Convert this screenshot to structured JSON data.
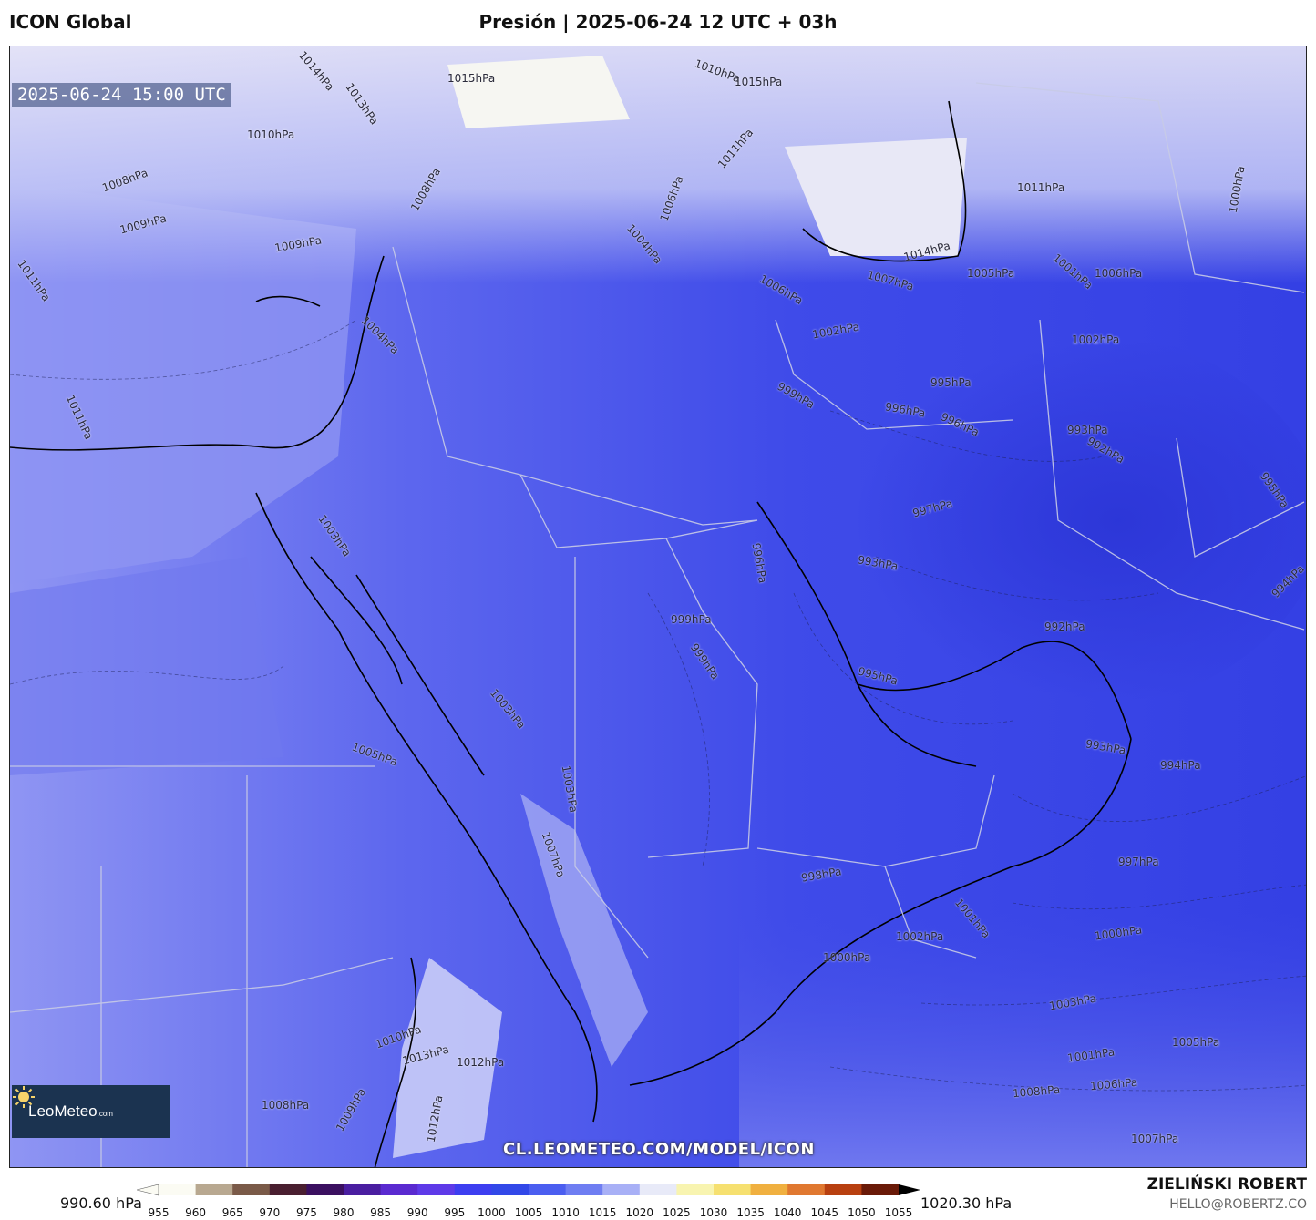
{
  "header": {
    "model": "ICON Global",
    "title": "Presión | 2025-06-24 12 UTC + 03h"
  },
  "map": {
    "valid_time": "2025-06-24 15:00 UTC",
    "url": "CL.LEOMETEO.COM/MODEL/ICON",
    "logo": {
      "name": "LeoMeteo",
      "suffix": ".com"
    },
    "isobar_labels": [
      "1015hPa",
      "1014hPa",
      "1013hPa",
      "1010hPa",
      "1008hPa",
      "1009hPa",
      "1009hPa",
      "1011hPa",
      "1008hPa",
      "1004hPa",
      "1011hPa",
      "1003hPa",
      "1003hPa",
      "1010hPa",
      "1015hPa",
      "1011hPa",
      "1006hPa",
      "1004hPa",
      "1006hPa",
      "1007hPa",
      "1014hPa",
      "1011hPa",
      "1005hPa",
      "1001hPa",
      "1006hPa",
      "1000hPa",
      "1002hPa",
      "1002hPa",
      "995hPa",
      "996hPa",
      "996hPa",
      "999hPa",
      "993hPa",
      "992hPa",
      "997hPa",
      "993hPa",
      "992hPa",
      "995hPa",
      "994hPa",
      "999hPa",
      "999hPa",
      "996hPa",
      "995hPa",
      "993hPa",
      "994hPa",
      "1003hPa",
      "1005hPa",
      "1001hPa",
      "1007hPa",
      "998hPa",
      "1001hPa",
      "1002hPa",
      "1000hPa",
      "1000hPa",
      "997hPa",
      "1003hPa",
      "1005hPa",
      "1006hPa",
      "1007hPa",
      "1008hPa",
      "1010hPa",
      "1013hPa",
      "1012hPa",
      "1008hPa",
      "1009hPa",
      "1012hPa"
    ]
  },
  "legend": {
    "min_label": "990.60 hPa",
    "max_label": "1020.30 hPa",
    "ticks": [
      "955",
      "960",
      "965",
      "970",
      "975",
      "980",
      "985",
      "990",
      "995",
      "1000",
      "1005",
      "1010",
      "1015",
      "1020",
      "1025",
      "1030",
      "1035",
      "1040",
      "1045",
      "1050",
      "1055"
    ],
    "colors": [
      "#fbfbf3",
      "#b8a890",
      "#7a5a48",
      "#4a1f30",
      "#3b1060",
      "#4a1ea0",
      "#5a2ad0",
      "#5e3ae8",
      "#3d3ef0",
      "#3248e8",
      "#4b5ef0",
      "#6f7ef2",
      "#a8b0f6",
      "#e8eaf8",
      "#f8f4b0",
      "#f6e070",
      "#f0b040",
      "#e07830",
      "#b84010",
      "#6a1a08",
      "#000000"
    ]
  },
  "credits": {
    "author": "ZIELIŃSKI ROBERT",
    "email": "HELLO@ROBERTZ.CO"
  }
}
